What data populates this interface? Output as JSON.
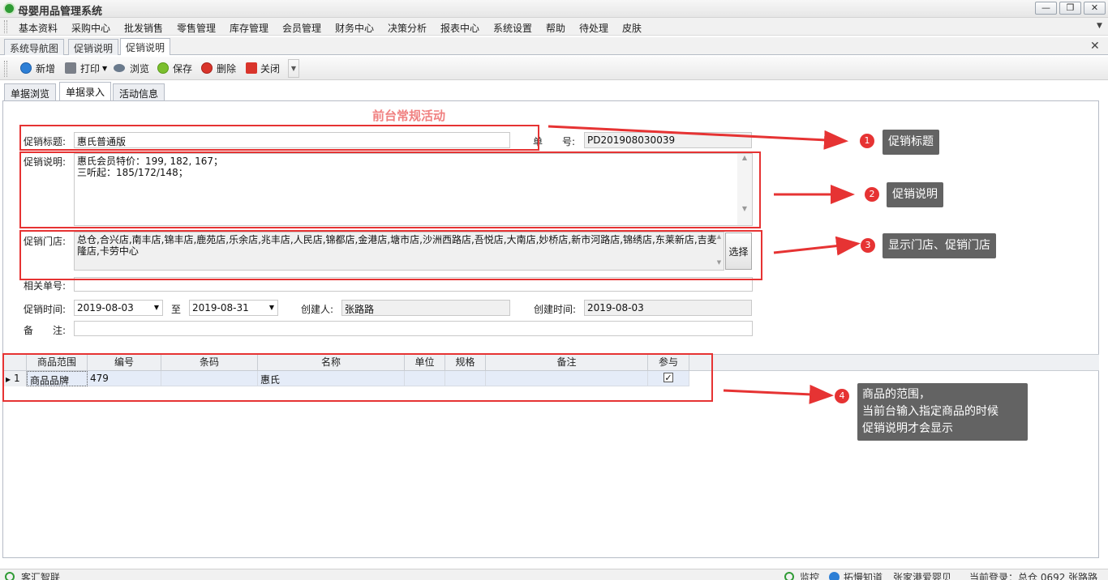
{
  "app": {
    "title": "母婴用品管理系统"
  },
  "window_buttons": [
    "—",
    "❐",
    "✕"
  ],
  "menu": [
    "基本资料",
    "采购中心",
    "批发销售",
    "零售管理",
    "库存管理",
    "会员管理",
    "财务中心",
    "决策分析",
    "报表中心",
    "系统设置",
    "帮助",
    "待处理",
    "皮肤"
  ],
  "doc_tabs": [
    "系统导航图",
    "促销说明",
    "促销说明"
  ],
  "toolbar": {
    "new": "新增",
    "print": "打印",
    "browse": "浏览",
    "save": "保存",
    "delete": "删除",
    "close": "关闭"
  },
  "main_tabs": [
    "单据浏览",
    "单据录入",
    "活动信息"
  ],
  "form": {
    "heading": "前台常规活动",
    "title_label": "促销标题:",
    "title_value": "惠氏普通版",
    "doc_no_label": "单　　号:",
    "doc_no_value": "PD201908030039",
    "desc_label": "促销说明:",
    "desc_value": "惠氏会员特价：199, 182, 167；\n三听起：185/172/148；",
    "stores_label": "促销门店:",
    "stores_value": "总仓,合兴店,南丰店,锦丰店,鹿苑店,乐余店,兆丰店,人民店,锦都店,金港店,塘市店,沙洲西路店,吾悦店,大南店,妙桥店,新市河路店,锦绣店,东莱新店,吉麦隆店,卡劳中心",
    "choose_btn": "选择",
    "related_label": "相关单号:",
    "time_label": "促销时间:",
    "start_date": "2019-08-03",
    "to_label": "至",
    "end_date": "2019-08-31",
    "creator_label": "创建人:",
    "creator_value": "张路路",
    "created_label": "创建时间:",
    "created_value": "2019-08-03",
    "remark_label": "备　　注:"
  },
  "grid": {
    "headers": [
      "商品范围",
      "编号",
      "条码",
      "名称",
      "单位",
      "规格",
      "备注",
      "参与"
    ],
    "rows": [
      {
        "idx": "1",
        "scope": "商品品牌",
        "code": "479",
        "barcode": "",
        "name": "惠氏",
        "unit": "",
        "spec": "",
        "note": "",
        "checked": "✓"
      }
    ]
  },
  "annotations": [
    {
      "num": "1",
      "text": "促销标题"
    },
    {
      "num": "2",
      "text": "促销说明"
    },
    {
      "num": "3",
      "text": "显示门店、促销门店"
    },
    {
      "num": "4",
      "line1": "商品的范围，",
      "line2": "当前台输入指定商品的时候",
      "line3": "促销说明才会显示"
    }
  ],
  "status": {
    "left": "客汇智联",
    "monitor": "监控",
    "help": "拓慢知道",
    "store": "张家港爱婴贝",
    "login": "当前登录：总仓 0692 张路路"
  },
  "colors": {
    "accent": "#e63333",
    "callout": "#636363",
    "heading": "#f08080"
  }
}
